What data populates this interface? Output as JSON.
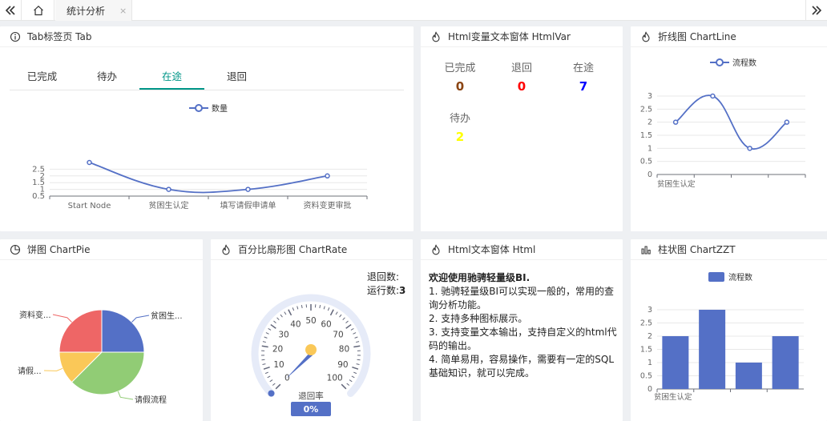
{
  "topbar": {
    "tab_label": "统计分析",
    "tab_close": "×"
  },
  "panels": {
    "tab": {
      "title": "Tab标签页 Tab",
      "tabs": [
        "已完成",
        "待办",
        "在途",
        "退回"
      ],
      "active_tab": "在途"
    },
    "htmlvar": {
      "title": "Html变量文本窗体 HtmlVar",
      "vars": [
        {
          "label": "已完成",
          "value": "0",
          "color": "#8b4513"
        },
        {
          "label": "退回",
          "value": "0",
          "color": "#ff0000"
        },
        {
          "label": "在途",
          "value": "7",
          "color": "#0000ff"
        },
        {
          "label": "待办",
          "value": "2",
          "color": "#ffff00"
        }
      ]
    },
    "chartline": {
      "title": "折线图 ChartLine"
    },
    "chartpie": {
      "title": "饼图 ChartPie"
    },
    "chartrate": {
      "title": "百分比扇形图 ChartRate",
      "info_return": "退回数:",
      "info_running": "运行数:",
      "info_running_value": "3",
      "gauge_label": "退回率",
      "gauge_value": "0%"
    },
    "html": {
      "title": "Html文本窗体 Html",
      "heading": "欢迎使用驰骋轻量级BI.",
      "lines": [
        "1. 驰骋轻量级BI可以实现一般的，常用的查询分析功能。",
        "2. 支持多种图标展示。",
        "3. 支持变量文本输出，支持自定义的html代码的输出。",
        "4. 简单易用，容易操作，需要有一定的SQL基础知识，就可以完成。"
      ]
    },
    "chartzzt": {
      "title": "柱状图 ChartZZT"
    }
  },
  "chart_data": [
    {
      "id": "tab-line",
      "type": "line",
      "legend": [
        "数量"
      ],
      "categories": [
        "Start Node",
        "贫困生认定",
        "填写请假申请单",
        "资料变更审批"
      ],
      "series": [
        {
          "name": "数量",
          "values": [
            3,
            1,
            1,
            2
          ]
        }
      ],
      "yticks": [
        "0.5",
        "1",
        "1.5",
        "2",
        "2.5"
      ],
      "ylim": [
        0.5,
        3
      ],
      "color": "#5470c6"
    },
    {
      "id": "chartline",
      "type": "line",
      "legend": [
        "流程数"
      ],
      "categories": [
        "贫困生认定",
        "",
        "",
        ""
      ],
      "series": [
        {
          "name": "流程数",
          "values": [
            2,
            3,
            1,
            2
          ]
        }
      ],
      "yticks": [
        "0",
        "0.5",
        "1",
        "1.5",
        "2",
        "2.5",
        "3"
      ],
      "ylim": [
        0,
        3
      ],
      "color": "#5470c6"
    },
    {
      "id": "chartpie",
      "type": "pie",
      "slices": [
        {
          "label": "贫困生...",
          "value": 1,
          "color": "#5470c6"
        },
        {
          "label": "请假流程",
          "value": 1.5,
          "color": "#91cc75"
        },
        {
          "label": "请假...",
          "value": 0.5,
          "color": "#fac858"
        },
        {
          "label": "资料变...",
          "value": 1,
          "color": "#ee6666"
        }
      ]
    },
    {
      "id": "chartrate",
      "type": "gauge",
      "ticks": [
        "0",
        "10",
        "20",
        "30",
        "40",
        "50",
        "60",
        "70",
        "80",
        "90",
        "100"
      ],
      "value": 0
    },
    {
      "id": "chartzzt",
      "type": "bar",
      "legend": [
        "流程数"
      ],
      "categories": [
        "贫困生认定",
        "",
        "",
        ""
      ],
      "series": [
        {
          "name": "流程数",
          "values": [
            2,
            3,
            1,
            2
          ]
        }
      ],
      "yticks": [
        "0",
        "0.5",
        "1",
        "1.5",
        "2",
        "2.5",
        "3"
      ],
      "ylim": [
        0,
        3
      ],
      "color": "#5470c6"
    }
  ]
}
